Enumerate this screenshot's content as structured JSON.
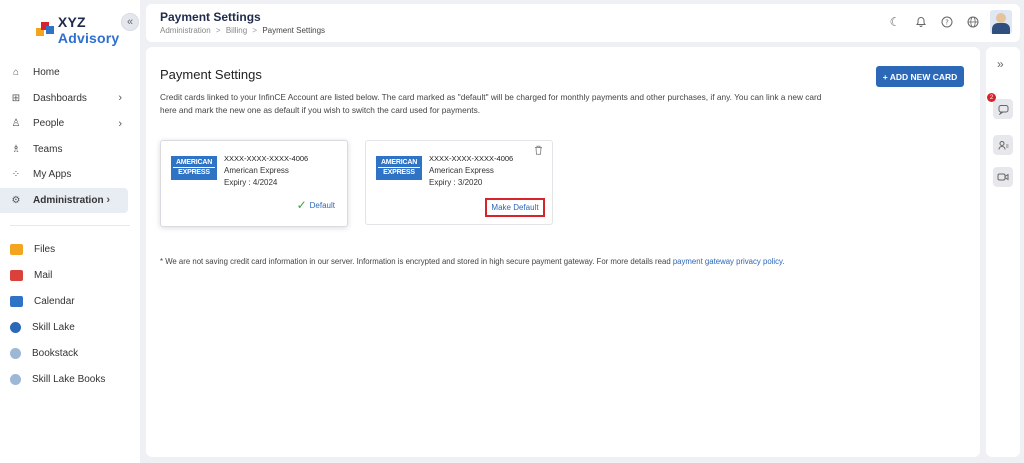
{
  "brand": {
    "name": "XYZ",
    "name_accent": "Advisory"
  },
  "sidebar": {
    "collapse_icon": "«",
    "nav": [
      {
        "label": "Home",
        "icon": "home-icon",
        "glyph": "⌂"
      },
      {
        "label": "Dashboards",
        "icon": "dashboard-icon",
        "glyph": "⊞",
        "chevron": "›"
      },
      {
        "label": "People",
        "icon": "person-icon",
        "glyph": "♙",
        "chevron": "›"
      },
      {
        "label": "Teams",
        "icon": "teams-icon",
        "glyph": "♗"
      },
      {
        "label": "My Apps",
        "icon": "apps-icon",
        "glyph": "⁘"
      },
      {
        "label": "Administration",
        "icon": "admin-gear-icon",
        "glyph": "⚙",
        "chevron": "›"
      }
    ],
    "apps": [
      {
        "label": "Files",
        "icon": "folder-icon",
        "color": "#f3a51f"
      },
      {
        "label": "Mail",
        "icon": "mail-icon",
        "color": "#d9413a"
      },
      {
        "label": "Calendar",
        "icon": "calendar-icon",
        "color": "#2f73c7"
      },
      {
        "label": "Skill Lake",
        "icon": "skill-lake-icon",
        "color": "#2b68b8"
      },
      {
        "label": "Bookstack",
        "icon": "bookstack-icon",
        "color": "#9db7d6"
      },
      {
        "label": "Skill Lake Books",
        "icon": "skill-lake-books-icon",
        "color": "#9db7d6"
      }
    ]
  },
  "header": {
    "title": "Payment Settings",
    "breadcrumb": [
      "Administration",
      "Billing",
      "Payment Settings"
    ],
    "breadcrumb_sep": ">"
  },
  "main": {
    "title": "Payment Settings",
    "add_button": "+ ADD NEW CARD",
    "description": "Credit cards linked to your InfinCE Account are listed below. The card marked as \"default\" will be charged for monthly payments and other purchases, if any. You can link a new card here and mark the new one as default if you wish to switch the card used for payments.",
    "cards": [
      {
        "number": "XXXX-XXXX-XXXX-4006",
        "brand": "American Express",
        "expiry": "Expiry : 4/2024",
        "is_default": true,
        "default_label": "Default",
        "logo_top": "AMERICAN",
        "logo_bottom": "EXPRESS"
      },
      {
        "number": "XXXX-XXXX-XXXX-4006",
        "brand": "American Express",
        "expiry": "Expiry : 3/2020",
        "is_default": false,
        "make_default_label": "Make Default",
        "logo_top": "AMERICAN",
        "logo_bottom": "EXPRESS"
      }
    ],
    "footnote": "* We are not saving credit card information in our server. Information is encrypted and stored in high secure payment gateway. For more details read",
    "footnote_link": "payment gateway privacy policy."
  },
  "rail": {
    "expand_icon": "»",
    "notification_count": "2"
  },
  "colors": {
    "primary": "#2b68b8",
    "highlight_border": "#d9232b",
    "success": "#3aa53a"
  }
}
